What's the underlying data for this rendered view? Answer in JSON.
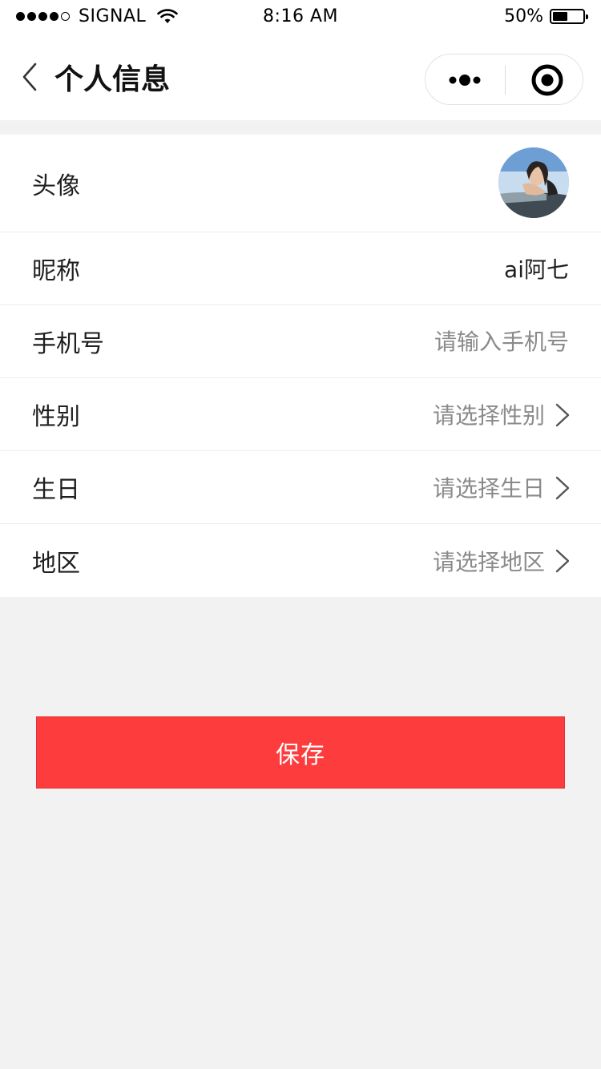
{
  "status_bar": {
    "carrier": "SIGNAL",
    "time": "8:16 AM",
    "battery": "50%",
    "battery_level": 0.5,
    "signal_bars_filled": 4,
    "signal_bars_total": 5
  },
  "nav": {
    "title": "个人信息",
    "back_icon": "chevron-left-icon",
    "more_icon": "more-dots-icon",
    "close_icon": "target-close-icon"
  },
  "profile": {
    "avatar_label": "头像",
    "nickname_label": "昵称",
    "nickname_value": "ai阿七",
    "phone_label": "手机号",
    "phone_placeholder": "请输入手机号",
    "gender_label": "性别",
    "gender_placeholder": "请选择性别",
    "birthday_label": "生日",
    "birthday_placeholder": "请选择生日",
    "region_label": "地区",
    "region_placeholder": "请选择地区"
  },
  "actions": {
    "save_label": "保存"
  },
  "colors": {
    "primary": "#fd3c3d",
    "background": "#f2f2f2",
    "placeholder": "#8a8a8a"
  }
}
